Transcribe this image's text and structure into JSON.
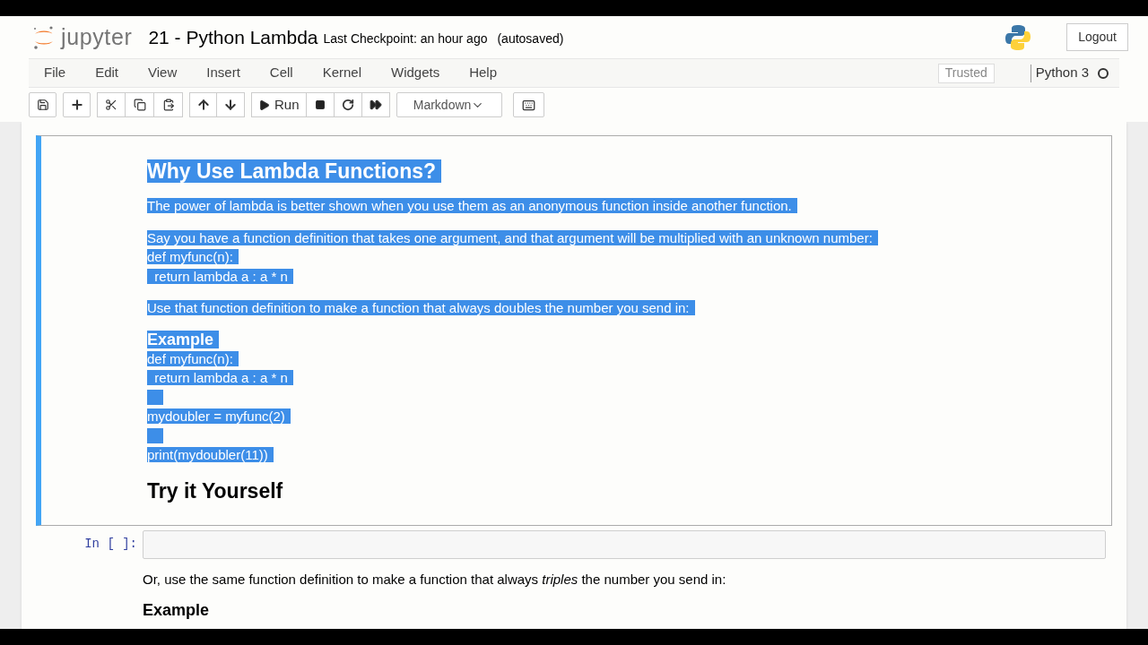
{
  "header": {
    "brand": "jupyter",
    "title": "21 - Python Lambda",
    "checkpoint": "Last Checkpoint: an hour ago",
    "autosave": "(autosaved)",
    "logout": "Logout"
  },
  "menu": [
    "File",
    "Edit",
    "View",
    "Insert",
    "Cell",
    "Kernel",
    "Widgets",
    "Help"
  ],
  "trusted": "Trusted",
  "kernel": {
    "name": "Python 3",
    "busy": false
  },
  "toolbar": {
    "run": "Run",
    "cell_type": "Markdown"
  },
  "cells": [
    {
      "kind": "markdown",
      "selected": true,
      "blocks": [
        {
          "kind": "h1",
          "text": "Why Use Lambda Functions?",
          "highlighted": true
        },
        {
          "kind": "p",
          "text": "The power of lambda is better shown when you use them as an anonymous function inside another function.",
          "highlighted": true
        },
        {
          "kind": "line",
          "text": "Say you have a function definition that takes one argument, and that argument will be multiplied with an unknown number:",
          "highlighted": true
        },
        {
          "kind": "line",
          "text": "def myfunc(n):",
          "highlighted": true
        },
        {
          "kind": "p",
          "text": "  return lambda a : a * n",
          "highlighted": true
        },
        {
          "kind": "p",
          "text": "Use that function definition to make a function that always doubles the number you send in:",
          "highlighted": true
        },
        {
          "kind": "h2",
          "text": "Example",
          "highlighted": true
        },
        {
          "kind": "line",
          "text": "def myfunc(n):",
          "highlighted": true
        },
        {
          "kind": "line",
          "text": "  return lambda a : a * n",
          "highlighted": true
        },
        {
          "kind": "gap",
          "highlighted": true
        },
        {
          "kind": "line",
          "text": "mydoubler = myfunc(2)",
          "highlighted": true
        },
        {
          "kind": "gap",
          "highlighted": true
        },
        {
          "kind": "p",
          "text": "print(mydoubler(11))",
          "highlighted": true
        },
        {
          "kind": "h1",
          "text": "Try it Yourself",
          "highlighted": false
        }
      ]
    },
    {
      "kind": "code",
      "selected": false,
      "prompt": "In [ ]:"
    },
    {
      "kind": "markdown",
      "selected": false,
      "blocks": [
        {
          "kind": "p",
          "text": "Or, use the same function definition to make a function that always *triples* the number you send in:",
          "highlighted": false
        },
        {
          "kind": "h2",
          "text": "Example",
          "highlighted": false
        }
      ]
    }
  ]
}
